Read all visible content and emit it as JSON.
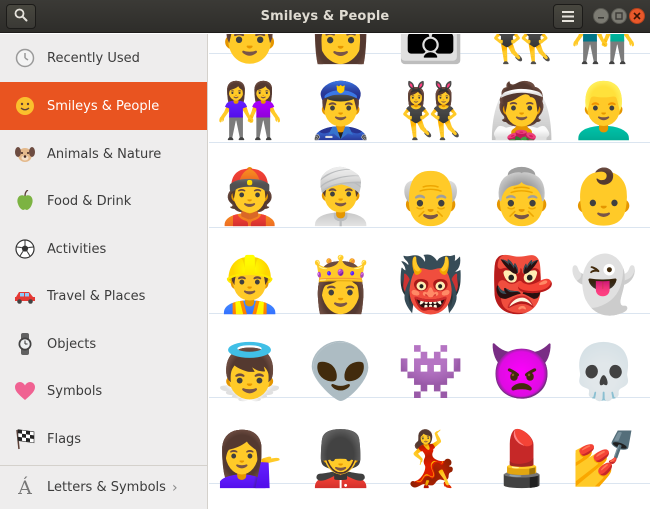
{
  "header": {
    "title": "Smileys & People",
    "search_icon": "search-icon",
    "menu_icon": "hamburger-menu-icon"
  },
  "sidebar": {
    "items": [
      {
        "label": "Recently Used",
        "icon": "clock-icon"
      },
      {
        "label": "Smileys & People",
        "icon": "smiley-icon",
        "active": true
      },
      {
        "label": "Animals & Nature",
        "icon": "dog-icon"
      },
      {
        "label": "Food & Drink",
        "icon": "apple-icon"
      },
      {
        "label": "Activities",
        "icon": "soccer-ball-icon"
      },
      {
        "label": "Travel & Places",
        "icon": "car-icon"
      },
      {
        "label": "Objects",
        "icon": "watch-icon"
      },
      {
        "label": "Symbols",
        "icon": "heart-icon"
      },
      {
        "label": "Flags",
        "icon": "chequered-flag-icon"
      }
    ],
    "footer": {
      "label": "Letters & Symbols",
      "chevron": "›",
      "icon": "accented-letter-icon",
      "glyph": "Á"
    }
  },
  "emoji_rows": [
    [
      "👨",
      "👩",
      "👪",
      "👯‍♂️",
      "👬"
    ],
    [
      "👭",
      "👮‍♂️",
      "👯‍♀️",
      "👰",
      "👱‍♂️"
    ],
    [
      "👲",
      "👳‍♂️",
      "👴",
      "👵",
      "👶"
    ],
    [
      "👷‍♂️",
      "👸",
      "👹",
      "👺",
      "👻"
    ],
    [
      "👼",
      "👽",
      "👾",
      "👿",
      "💀"
    ],
    [
      "💁‍♀️",
      "💂‍♂️",
      "💃",
      "💄",
      "💅"
    ]
  ],
  "colors": {
    "accent": "#e95420",
    "header_bg": "#2e2d2a",
    "sidebar_bg": "#eeeded"
  }
}
